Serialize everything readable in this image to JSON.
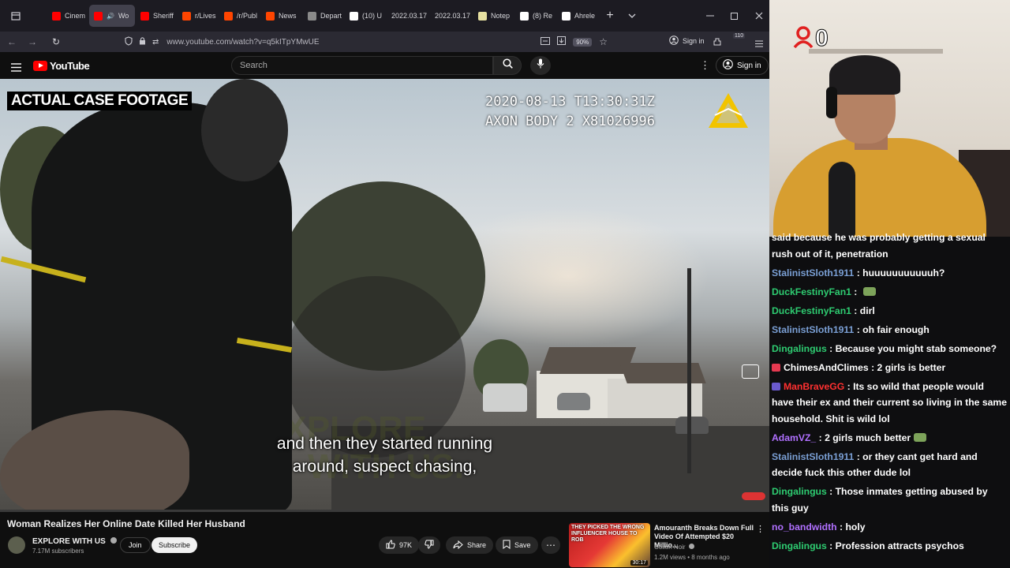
{
  "browser": {
    "tabs": [
      {
        "label": "Cinem",
        "favicon_color": "#ff0000",
        "active": false
      },
      {
        "label": "Wo",
        "favicon_color": "#ff0000",
        "active": true
      },
      {
        "label": "Sheriff",
        "favicon_color": "#ff0000",
        "active": false
      },
      {
        "label": "r/Lives",
        "favicon_color": "#ff4500",
        "active": false
      },
      {
        "label": "/r/Publ",
        "favicon_color": "#ff4500",
        "active": false
      },
      {
        "label": "News",
        "favicon_color": "#ff4500",
        "active": false
      },
      {
        "label": "Depart",
        "favicon_color": "#8a8a8a",
        "active": false
      },
      {
        "label": "(10) U",
        "favicon_color": "#ffffff",
        "active": false
      },
      {
        "label": "2022.03.17",
        "favicon_color": "",
        "active": false
      },
      {
        "label": "2022.03.17",
        "favicon_color": "",
        "active": false
      },
      {
        "label": "Notep",
        "favicon_color": "#e6e0a0",
        "active": false
      },
      {
        "label": "(8) Re",
        "favicon_color": "#ffffff",
        "active": false
      },
      {
        "label": "Ahrele",
        "favicon_color": "#ffffff",
        "active": false
      }
    ],
    "url": "www.youtube.com/watch?v=q5kITpYMwUE",
    "zoom": "90%",
    "signin_label": "Sign in",
    "extension_badge": "110"
  },
  "youtube": {
    "logo_text": "YouTube",
    "search_placeholder": "Search",
    "signin_label": "Sign in"
  },
  "video": {
    "overlay_label": "ACTUAL CASE FOOTAGE",
    "timestamp_line1": "2020-08-13 T13:30:31Z",
    "timestamp_line2": "AXON BODY 2 X81026996",
    "caption_line1": "and then they started running",
    "caption_line2": "around, suspect chasing,",
    "watermark_line1": "EXPLORE",
    "watermark_line2": "WITH US.",
    "progress": 0.0
  },
  "below_video": {
    "title": "Woman Realizes Her Online Date Killed Her Husband",
    "channel_name": "EXPLORE WITH US",
    "subscribers": "7.17M subscribers",
    "join_label": "Join",
    "subscribe_label": "Subscribe",
    "like_count": "97K",
    "share_label": "Share",
    "save_label": "Save"
  },
  "recommended": {
    "thumb_text": "THEY PICKED THE WRONG INFLUENCER HOUSE TO ROB",
    "duration": "30:17",
    "title": "Amouranth Breaks Down Full Video Of Attempted $20 Millio...",
    "channel": "Colion Noir",
    "meta": "1.2M views • 8 months ago"
  },
  "stream": {
    "cam_badge_count": "0",
    "chat": [
      {
        "user": "",
        "user_color": "#ffffff",
        "badge_color": "",
        "text": "said because he was probably getting a sexual rush out of it, penetration",
        "emote": false
      },
      {
        "user": "StalinistSloth1911",
        "user_color": "#7a9fd4",
        "badge_color": "",
        "text": "huuuuuuuuuuuh?",
        "emote": false
      },
      {
        "user": "DuckFestinyFan1",
        "user_color": "#2ecc71",
        "badge_color": "",
        "text": "",
        "emote": true
      },
      {
        "user": "DuckFestinyFan1",
        "user_color": "#2ecc71",
        "badge_color": "",
        "text": "dirl",
        "emote": false
      },
      {
        "user": "StalinistSloth1911",
        "user_color": "#7a9fd4",
        "badge_color": "",
        "text": "oh fair enough",
        "emote": false
      },
      {
        "user": "Dingalingus",
        "user_color": "#2ecc71",
        "badge_color": "",
        "text": "Because you might stab someone?",
        "emote": false
      },
      {
        "user": "ChimesAndClimes",
        "user_color": "#ffffff",
        "badge_color": "#e53950",
        "text": "2 girls is better",
        "emote": false
      },
      {
        "user": "ManBraveGG",
        "user_color": "#ff3030",
        "badge_color": "#6a5acd",
        "text": "Its so wild that people would have their ex and their current so living in the same household. Shit is wild lol",
        "emote": false
      },
      {
        "user": "AdamVZ_",
        "user_color": "#b070ff",
        "badge_color": "",
        "text": "2 girls much better",
        "emote": true
      },
      {
        "user": "StalinistSloth1911",
        "user_color": "#7a9fd4",
        "badge_color": "",
        "text": "or they cant get hard and decide fuck this other dude lol",
        "emote": false
      },
      {
        "user": "Dingalingus",
        "user_color": "#2ecc71",
        "badge_color": "",
        "text": "Those inmates getting abused by this guy",
        "emote": false
      },
      {
        "user": "no_bandwidth",
        "user_color": "#b070ff",
        "badge_color": "",
        "text": "holy",
        "emote": false
      },
      {
        "user": "Dingalingus",
        "user_color": "#2ecc71",
        "badge_color": "",
        "text": "Profession attracts psychos",
        "emote": false
      }
    ]
  }
}
